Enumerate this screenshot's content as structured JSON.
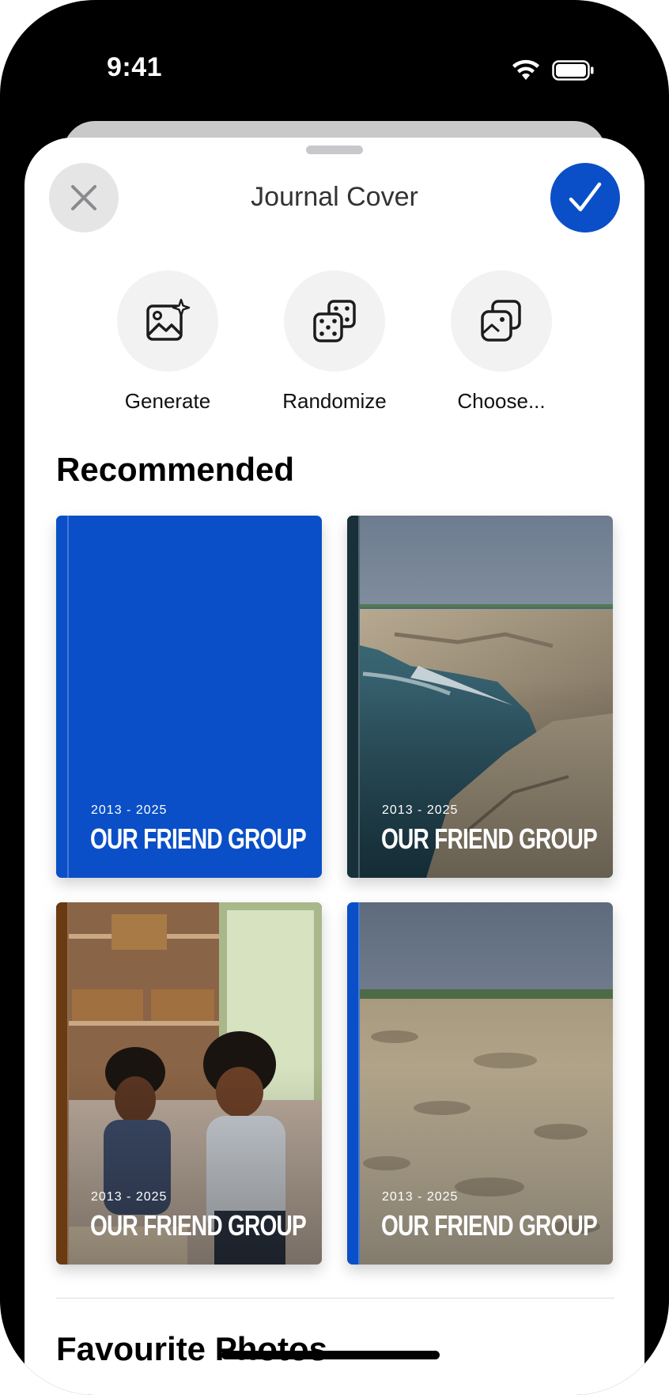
{
  "status_bar": {
    "time": "9:41"
  },
  "sheet": {
    "title": "Journal Cover",
    "close_icon": "close-icon",
    "confirm_icon": "checkmark-icon"
  },
  "actions": [
    {
      "label": "Generate",
      "icon": "sparkle-image-icon"
    },
    {
      "label": "Randomize",
      "icon": "dice-icon"
    },
    {
      "label": "Choose...",
      "icon": "photo-stack-icon"
    }
  ],
  "recommended": {
    "title": "Recommended",
    "covers": [
      {
        "years": "2013 - 2025",
        "title": "OUR FRIEND GROUP",
        "background": "solid-blue",
        "spine_color": "#0a4fc7"
      },
      {
        "years": "2013 - 2025",
        "title": "OUR FRIEND GROUP",
        "background": "rocky-coast-photo",
        "spine_color": "#17303a"
      },
      {
        "years": "2013 - 2025",
        "title": "OUR FRIEND GROUP",
        "background": "children-kitchen-photo",
        "spine_color": "#6a3a12"
      },
      {
        "years": "2013 - 2025",
        "title": "OUR FRIEND GROUP",
        "background": "limestone-plain-photo",
        "spine_color": "#0a4fc7"
      }
    ]
  },
  "favourite_photos": {
    "title": "Favourite Photos"
  },
  "colors": {
    "accent": "#0a4fc7",
    "control_gray": "#e5e5e5",
    "action_bg": "#f2f2f2"
  }
}
